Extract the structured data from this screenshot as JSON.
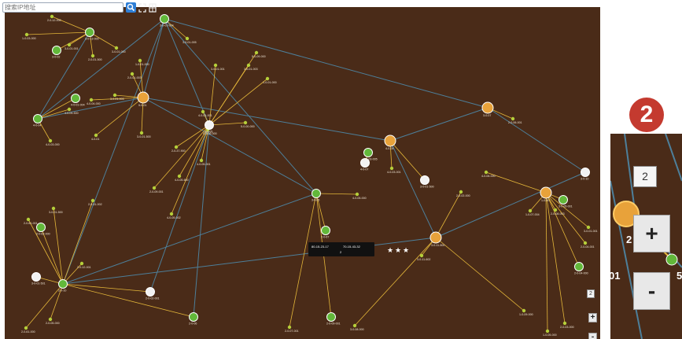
{
  "search": {
    "placeholder": "搜索IP地址"
  },
  "map": {
    "background": "#4a2b18",
    "link_color": "#4d7f9a",
    "cluster_link_color": "#e4b73a",
    "green_node_color": "#62b83a",
    "orange_node_color": "#e8a23a",
    "leaf_color": "#b5cf3a",
    "nodes": [
      {
        "label": "2-0-12-000",
        "kind": "leaf"
      },
      {
        "label": "1-0-03-000",
        "kind": "leaf"
      },
      {
        "label": "3-0-13-000",
        "kind": "green"
      },
      {
        "label": "3-0-01-001",
        "kind": "leaf"
      },
      {
        "label": "3-0-02",
        "kind": "green"
      },
      {
        "label": "2-0-01-500",
        "kind": "leaf"
      },
      {
        "label": "3-0-01-000",
        "kind": "leaf"
      },
      {
        "label": "1-0-01-000",
        "kind": "leaf"
      },
      {
        "label": "2-0-01-003",
        "kind": "leaf"
      },
      {
        "label": "3-0-01-004",
        "kind": "green"
      },
      {
        "label": "3-0-01-005",
        "kind": "leaf"
      },
      {
        "label": "3-0-01-001",
        "kind": "leaf"
      },
      {
        "label": "3-0-01-003",
        "kind": "leaf"
      },
      {
        "label": "1-0-01-000",
        "kind": "leaf"
      },
      {
        "label": "4-0-04",
        "kind": "green"
      },
      {
        "label": "4-0-04-500",
        "kind": "leaf"
      },
      {
        "label": "4-0-04-000",
        "kind": "leaf"
      },
      {
        "label": "3-0-01-003",
        "kind": "leaf"
      },
      {
        "label": "4-0-01-004",
        "kind": "green"
      },
      {
        "label": "4-0-03-000",
        "kind": "leaf"
      },
      {
        "label": "4-0-01",
        "kind": "leaf"
      },
      {
        "label": "3-0-01-500",
        "kind": "leaf"
      },
      {
        "label": "4-0-01-001",
        "kind": "leaf"
      },
      {
        "label": "5-0-01",
        "kind": "orange"
      },
      {
        "label": "5-0-06-000",
        "kind": "leaf"
      },
      {
        "label": "5-0-00-000",
        "kind": "leaf"
      },
      {
        "label": "5-0-09-000",
        "kind": "leaf"
      },
      {
        "label": "4-0-05-001",
        "kind": "leaf"
      },
      {
        "label": "2-0-05",
        "kind": "white"
      },
      {
        "label": "2-0-09-001",
        "kind": "leaf"
      },
      {
        "label": "2-0-37-900",
        "kind": "leaf"
      },
      {
        "label": "4-0-05-600",
        "kind": "leaf"
      },
      {
        "label": "4-0-05-002",
        "kind": "leaf"
      },
      {
        "label": "3-0-05",
        "kind": "green"
      },
      {
        "label": "4-0-05",
        "kind": "orange"
      },
      {
        "label": "4-0-07",
        "kind": "white"
      },
      {
        "label": "4-0-05-000",
        "kind": "leaf"
      },
      {
        "label": "4-0-03-005",
        "kind": "green"
      },
      {
        "label": "4-0-03-001",
        "kind": "leaf"
      },
      {
        "label": "2-0-67",
        "kind": "green"
      },
      {
        "label": "2-0-62-000",
        "kind": "green"
      },
      {
        "label": "2-0-61-001",
        "kind": "leaf"
      },
      {
        "label": "3-0-01-500",
        "kind": "leaf"
      },
      {
        "label": "2-0-31-002",
        "kind": "leaf"
      },
      {
        "label": "2-0-10",
        "kind": "green"
      },
      {
        "label": "3-0-01-501",
        "kind": "white"
      },
      {
        "label": "2-0-61-000",
        "kind": "leaf"
      },
      {
        "label": "2-0-05-000",
        "kind": "leaf"
      },
      {
        "label": "2-0-12-001",
        "kind": "leaf"
      },
      {
        "label": "2-0-02-001",
        "kind": "white"
      },
      {
        "label": "2-0-06",
        "kind": "green"
      },
      {
        "label": "2-0-07-001",
        "kind": "leaf"
      },
      {
        "label": "2-0-09-001",
        "kind": "green"
      },
      {
        "label": "3-0-08-000",
        "kind": "leaf"
      },
      {
        "label": "3-0-11-500",
        "kind": "orange"
      },
      {
        "label": "3-0-11-602",
        "kind": "leaf"
      },
      {
        "label": "3-0-01-500",
        "kind": "white"
      },
      {
        "label": "2-0-02-000",
        "kind": "leaf"
      },
      {
        "label": "4-0-06-000",
        "kind": "leaf"
      },
      {
        "label": "3-0-07",
        "kind": "orange"
      },
      {
        "label": "2-0-06-001",
        "kind": "leaf"
      },
      {
        "label": "1-0-00",
        "kind": "orange"
      },
      {
        "label": "1-0-07-004",
        "kind": "leaf"
      },
      {
        "label": "2-0-08-003",
        "kind": "leaf"
      },
      {
        "label": "3-0-05-001",
        "kind": "green"
      },
      {
        "label": "3-0-10",
        "kind": "white"
      },
      {
        "label": "2-0-03-000",
        "kind": "leaf"
      },
      {
        "label": "1-0-09-000",
        "kind": "leaf"
      },
      {
        "label": "1-0-05-000",
        "kind": "leaf"
      },
      {
        "label": "2-0-04-000",
        "kind": "green"
      },
      {
        "label": "3-0-01-001",
        "kind": "leaf"
      },
      {
        "label": "2-0-04-001",
        "kind": "leaf"
      }
    ]
  },
  "tooltip": {
    "line1_left": "80-15-23-17",
    "line1_right": "70-15-43-32",
    "line2": "2"
  },
  "mini_controls": {
    "counter": "2",
    "zoom_in": "+",
    "zoom_out": "-"
  },
  "callout": {
    "badge_number": "2",
    "badge_color": "#c43a2f",
    "counter": "2",
    "zoom_in": "+",
    "zoom_out": "-",
    "label_left": "01",
    "label_digit": "2",
    "label_right": "5"
  }
}
